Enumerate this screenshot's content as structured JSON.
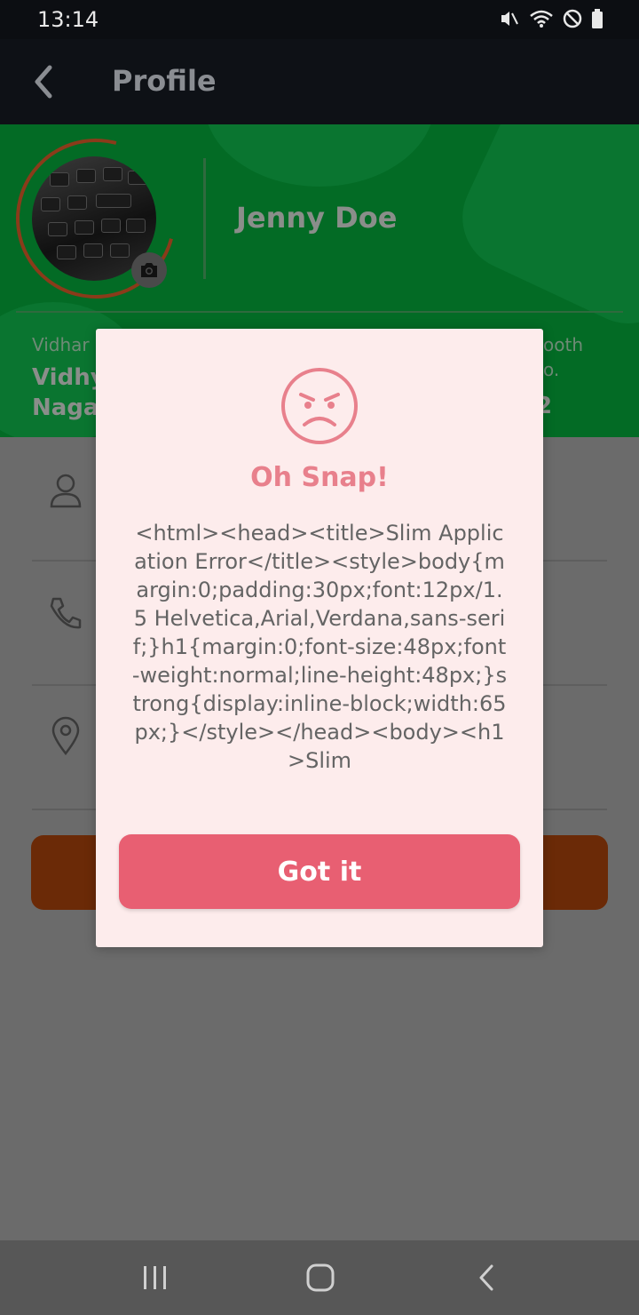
{
  "status_bar": {
    "time": "13:14",
    "icons": [
      "mute-icon",
      "wifi-icon",
      "dnd-icon",
      "battery-icon"
    ]
  },
  "app_bar": {
    "title": "Profile"
  },
  "profile": {
    "name": "Jenny Doe",
    "left_label": "Vidhar",
    "left_value_line1": "Vidhy",
    "left_value_line2": "Naga",
    "right_label_line1": "ooth",
    "right_label_line2": "o.",
    "right_value": "2"
  },
  "dialog": {
    "icon": "angry-face-icon",
    "title": "Oh Snap!",
    "message": "<html><head><title>Slim Application Error</title><style>body{margin:0;padding:30px;font:12px/1.5 Helvetica,Arial,Verdana,sans-serif;}h1{margin:0;font-size:48px;font-weight:normal;line-height:48px;}strong{display:inline-block;width:65px;}</style></head><body><h1>Slim",
    "button_label": "Got it"
  },
  "colors": {
    "header_green": "#036b25",
    "accent_orange": "#8a3b1a",
    "dialog_bg": "#fdecec",
    "dialog_button": "#e85f72",
    "dialog_title": "#e8808c"
  }
}
